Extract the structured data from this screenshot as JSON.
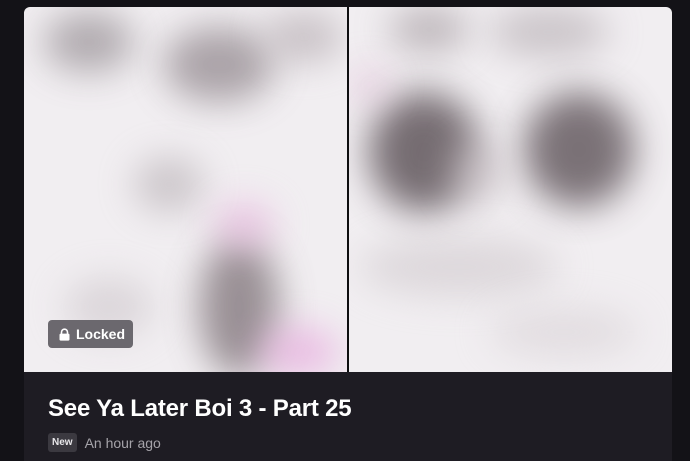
{
  "card": {
    "title": "See Ya Later Boi 3 - Part 25",
    "locked_label": "Locked",
    "new_label": "New",
    "timestamp": "An hour ago",
    "icons": {
      "lock": "lock-icon"
    }
  },
  "colors": {
    "page_background": "#131217",
    "card_background": "#1e1c23",
    "badge_background": "#6b686e",
    "new_badge_background": "#3b3940"
  }
}
